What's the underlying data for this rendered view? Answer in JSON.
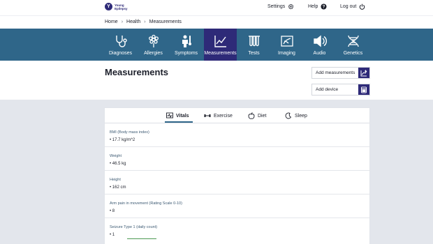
{
  "brand": {
    "logo_letter": "Y",
    "logo_text": "Young Epilepsy"
  },
  "topnav": {
    "settings": "Settings",
    "help": "Help",
    "logout": "Log out"
  },
  "breadcrumb": [
    "Home",
    "Health",
    "Measurements"
  ],
  "nav": {
    "items": [
      {
        "label": "Diagnoses",
        "icon": "stethoscope-icon"
      },
      {
        "label": "Allergies",
        "icon": "flower-icon"
      },
      {
        "label": "Symptoms",
        "icon": "person-thermometer-icon"
      },
      {
        "label": "Measurements",
        "icon": "chart-line-icon",
        "active": true
      },
      {
        "label": "Tests",
        "icon": "test-tubes-icon"
      },
      {
        "label": "Imaging",
        "icon": "x-ray-icon"
      },
      {
        "label": "Audio",
        "icon": "speaker-icon"
      },
      {
        "label": "Genetics",
        "icon": "dna-icon"
      }
    ]
  },
  "page": {
    "title": "Measurements"
  },
  "actions": {
    "add_measurements": "Add measurements",
    "add_device": "Add device"
  },
  "tabs": {
    "vitals": "Vitals",
    "exercise": "Exercise",
    "diet": "Diet",
    "sleep": "Sleep",
    "active": "Vitals"
  },
  "measurements": [
    {
      "label": "BMI (Body mass index)",
      "value": "• 17.7 kg/m^2"
    },
    {
      "label": "Weight",
      "value": "• 46.5 kg"
    },
    {
      "label": "Height",
      "value": "• 162 cm"
    },
    {
      "label": "Arm pain in movement (Rating Scale 0-10)",
      "value": "• 8"
    },
    {
      "label": "Seizure Type 1 (daily count)",
      "value": "• 1"
    }
  ],
  "colors": {
    "nav_bg": "#2f6689",
    "nav_active": "#2e2a78",
    "accent": "#2e2a78",
    "page_bg": "#e3e6ec",
    "trend_green": "#4c9a52"
  }
}
